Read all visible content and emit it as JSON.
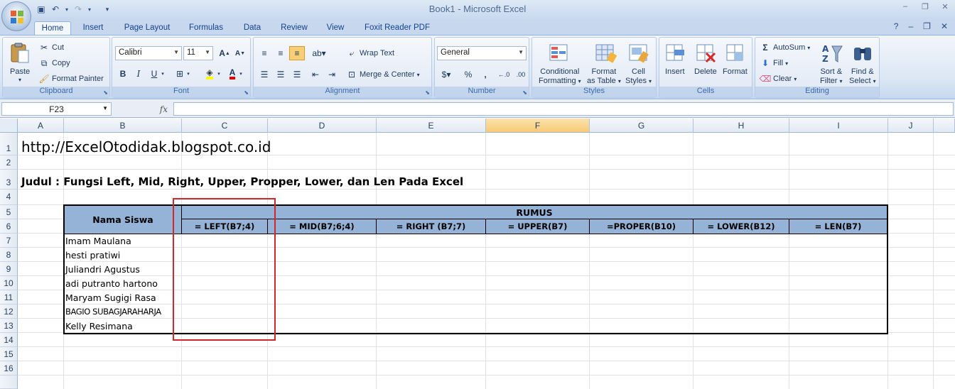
{
  "window": {
    "title": "Book1 - Microsoft Excel",
    "controls": [
      "–",
      "❐",
      "✕"
    ]
  },
  "ribbon": {
    "tabs": [
      "Home",
      "Insert",
      "Page Layout",
      "Formulas",
      "Data",
      "Review",
      "View",
      "Foxit Reader PDF"
    ],
    "active_tab": "Home",
    "clipboard": {
      "paste": "Paste",
      "cut": "Cut",
      "copy": "Copy",
      "format_painter": "Format Painter",
      "label": "Clipboard"
    },
    "font": {
      "name": "Calibri",
      "size": "11",
      "label": "Font"
    },
    "alignment": {
      "wrap_text": "Wrap Text",
      "merge_center": "Merge & Center",
      "label": "Alignment"
    },
    "number": {
      "format": "General",
      "label": "Number"
    },
    "styles": {
      "conditional_formatting_1": "Conditional",
      "conditional_formatting_2": "Formatting",
      "format_as_table_1": "Format",
      "format_as_table_2": "as Table",
      "cell_styles_1": "Cell",
      "cell_styles_2": "Styles",
      "label": "Styles"
    },
    "cells": {
      "insert": "Insert",
      "delete": "Delete",
      "format": "Format",
      "label": "Cells"
    },
    "editing": {
      "autosum": "AutoSum",
      "fill": "Fill",
      "clear": "Clear",
      "sort_filter_1": "Sort &",
      "sort_filter_2": "Filter",
      "find_select_1": "Find &",
      "find_select_2": "Select",
      "label": "Editing"
    }
  },
  "formula_bar": {
    "name_box": "F23",
    "fx": "fx",
    "formula": ""
  },
  "sheet": {
    "columns": [
      "A",
      "B",
      "C",
      "D",
      "E",
      "F",
      "G",
      "H",
      "I",
      "J"
    ],
    "selected_column": "F",
    "rows": [
      "1",
      "2",
      "3",
      "4",
      "5",
      "6",
      "7",
      "8",
      "9",
      "10",
      "11",
      "12",
      "13",
      "14",
      "15",
      "16"
    ],
    "url_text": "http://ExcelOtodidak.blogspot.co.id",
    "judul": "Judul : Fungsi Left, Mid, Right, Upper, Propper, Lower, dan Len Pada Excel",
    "table": {
      "nama_header": "Nama Siswa",
      "rumus_header": "RUMUS",
      "formulas": [
        "= LEFT(B7;4)",
        "= MID(B7;6;4)",
        "= RIGHT (B7;7)",
        "= UPPER(B7)",
        "=PROPER(B10)",
        "= LOWER(B12)",
        "= LEN(B7)"
      ],
      "names": [
        "Imam Maulana",
        "hesti pratiwi",
        "Juliandri Agustus",
        "adi putranto hartono",
        "Maryam Sugigi Rasa",
        "BAGIO SUBAGJARAHARJA",
        "Kelly Resimana"
      ]
    }
  },
  "colors": {
    "header_fill": "#95b3d7",
    "highlight_box": "#d0262c",
    "selected_column_header": "#f8cb77"
  }
}
